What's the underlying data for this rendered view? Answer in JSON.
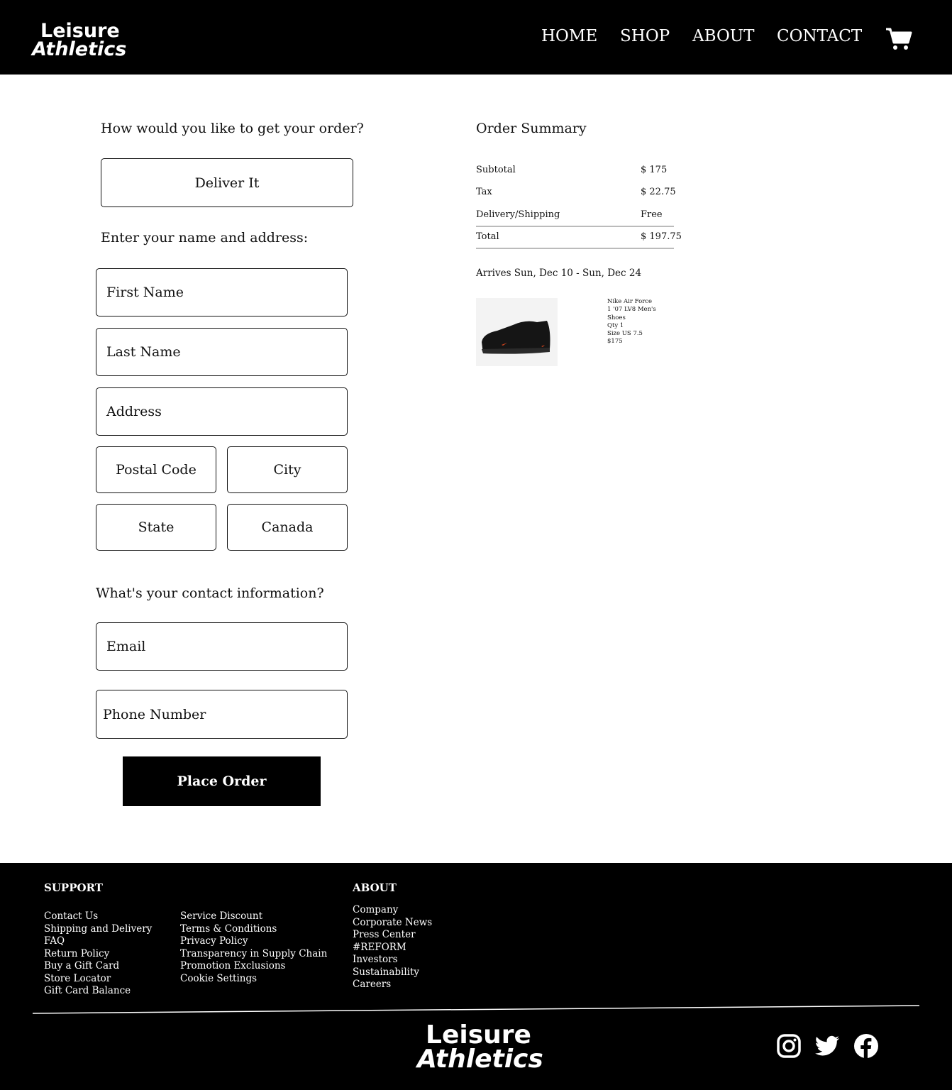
{
  "header": {
    "logo_line1": "Leisure",
    "logo_line2": "Athletics",
    "nav": [
      "HOME",
      "SHOP",
      "ABOUT",
      "CONTACT"
    ]
  },
  "form": {
    "delivery_question": "How would you like to get your order?",
    "delivery_option": "Deliver It",
    "address_heading": "Enter your name and address:",
    "first_name": "First Name",
    "last_name": "Last Name",
    "address": "Address",
    "postal_code": "Postal Code",
    "city": "City",
    "state": "State",
    "country": "Canada",
    "contact_heading": "What's your contact information?",
    "email": "Email",
    "phone": "Phone Number",
    "place_order": "Place Order"
  },
  "summary": {
    "title": "Order Summary",
    "rows": [
      {
        "label": "Subtotal",
        "value": "$ 175"
      },
      {
        "label": "Tax",
        "value": "$ 22.75"
      },
      {
        "label": "Delivery/Shipping",
        "value": "Free"
      },
      {
        "label": "Total",
        "value": "$ 197.75"
      }
    ],
    "arrives": "Arrives Sun, Dec 10 - Sun, Dec 24",
    "item": {
      "name": "Nike Air Force 1 '07 LV8 Men's Shoes",
      "qty": "Qty 1",
      "size": "Size US 7.5",
      "price": "$175"
    }
  },
  "footer": {
    "support_heading": "SUPPORT",
    "support_col1": [
      "Contact Us",
      "Shipping and Delivery",
      "FAQ",
      "Return Policy",
      "Buy a Gift Card",
      "Store Locator",
      "Gift Card Balance"
    ],
    "support_col2": [
      "Service Discount",
      "Terms & Conditions",
      "Privacy Policy",
      "Transparency in Supply Chain",
      "Promotion Exclusions",
      "Cookie Settings"
    ],
    "about_heading": "ABOUT",
    "about_items": [
      "Company",
      "Corporate News",
      "Press Center",
      "#REFORM",
      "Investors",
      "Sustainability",
      "Careers"
    ],
    "logo_line1": "Leisure",
    "logo_line2": "Athletics",
    "social": [
      "instagram-icon",
      "twitter-icon",
      "facebook-icon"
    ]
  }
}
